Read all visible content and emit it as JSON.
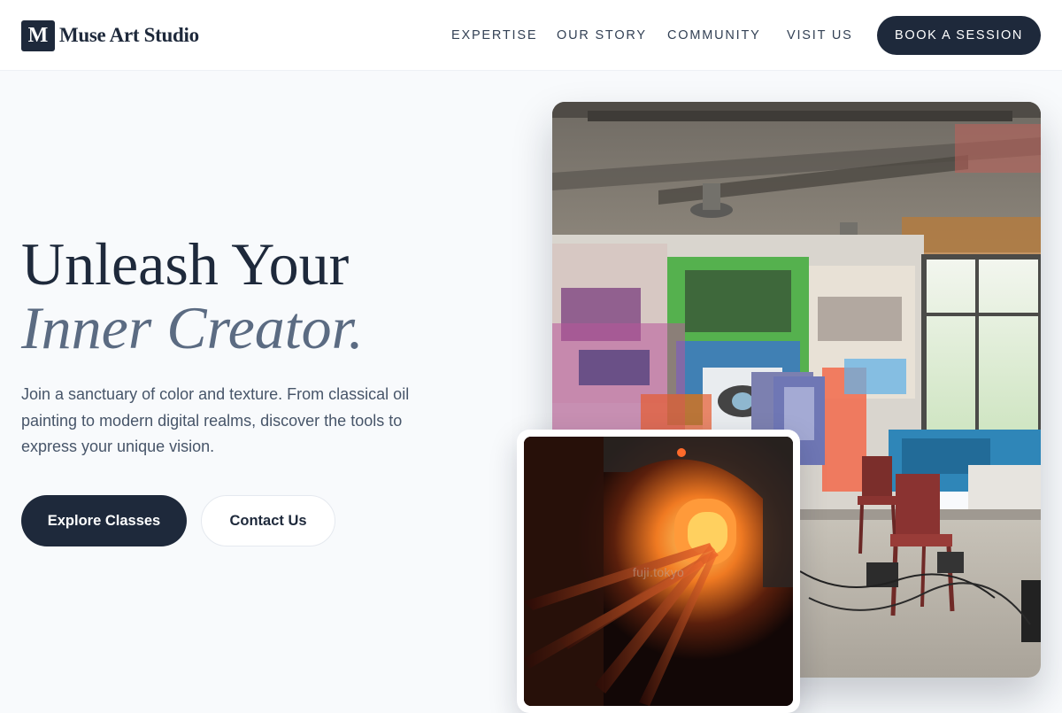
{
  "brand": {
    "mark": "M",
    "name": "Muse Art Studio"
  },
  "nav": {
    "items": [
      "EXPERTISE",
      "OUR STORY",
      "COMMUNITY",
      "VISIT US"
    ],
    "cta_label": "BOOK A SESSION"
  },
  "hero": {
    "title_line1": "Unleash Your",
    "title_line2": "Inner Creator.",
    "description": "Join a sanctuary of color and texture. From classical oil painting to modern digital realms, discover the tools to express your unique vision.",
    "primary_button": "Explore Classes",
    "secondary_button": "Contact Us"
  },
  "images": {
    "studio": "graffiti-art-studio-photo",
    "furnace": "glowing-furnace-photo",
    "furnace_watermark": "fuji.tokyo"
  },
  "colors": {
    "brand_dark": "#1e293b",
    "accent_slate": "#5b6b82",
    "background": "#f8fafc"
  }
}
